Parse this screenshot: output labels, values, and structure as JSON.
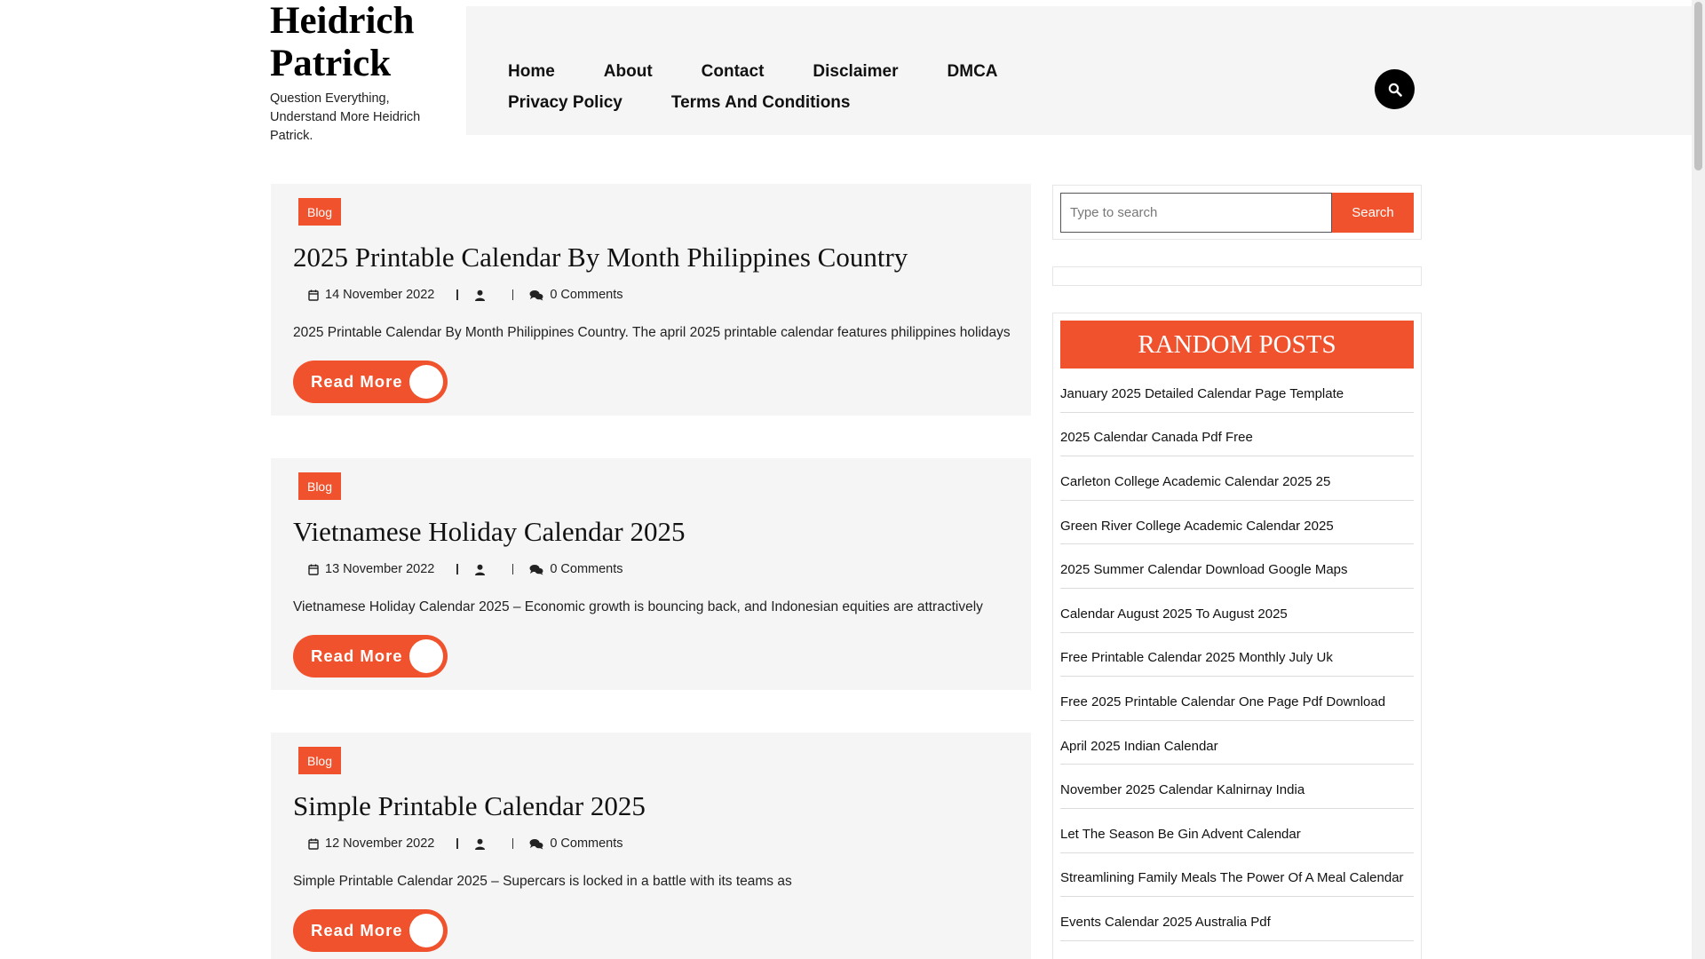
{
  "site": {
    "title": "Heidrich Patrick",
    "tagline": "Question Everything, Understand More Heidrich Patrick."
  },
  "nav": {
    "items": [
      "Home",
      "About",
      "Contact",
      "Disclaimer",
      "DMCA",
      "Privacy Policy",
      "Terms And Conditions"
    ],
    "search_icon": "search-icon"
  },
  "posts": [
    {
      "category": "Blog",
      "title": "2025 Printable Calendar By Month Philippines Country",
      "date": "14 November 2022",
      "author": "",
      "comments": "0 Comments",
      "excerpt": "2025 Printable Calendar By Month Philippines Country. The april 2025 printable calendar features philippines holidays",
      "read_more": "Read More"
    },
    {
      "category": "Blog",
      "title": "Vietnamese Holiday Calendar 2025",
      "date": "13 November 2022",
      "author": "",
      "comments": "0 Comments",
      "excerpt": "Vietnamese Holiday Calendar 2025 – Economic growth is bouncing back, and Indonesian equities are attractively",
      "read_more": "Read More"
    },
    {
      "category": "Blog",
      "title": "Simple Printable Calendar 2025",
      "date": "12 November 2022",
      "author": "",
      "comments": "0 Comments",
      "excerpt": "Simple Printable Calendar 2025 – Supercars is locked in a battle with its teams as",
      "read_more": "Read More"
    }
  ],
  "sidebar": {
    "search": {
      "placeholder": "Type to search",
      "button": "Search"
    },
    "random_posts": {
      "heading": "RANDOM POSTS",
      "items": [
        "January 2025 Detailed Calendar Page Template",
        "2025 Calendar Canada Pdf Free",
        "Carleton College Academic Calendar 2025 25",
        "Green River College Academic Calendar 2025",
        "2025 Summer Calendar Download Google Maps",
        "Calendar August 2025 To August 2025",
        "Free Printable Calendar 2025 Monthly July Uk",
        "Free 2025 Printable Calendar One Page Pdf Download",
        "April 2025 Indian Calendar",
        "November 2025 Calendar Kalnirnay India",
        "Let The Season Be Gin Advent Calendar",
        "Streamlining Family Meals The Power Of A Meal Calendar",
        "Events Calendar 2025 Australia Pdf"
      ]
    }
  },
  "colors": {
    "accent": "#f0522d",
    "panel": "#f5f5f5"
  }
}
